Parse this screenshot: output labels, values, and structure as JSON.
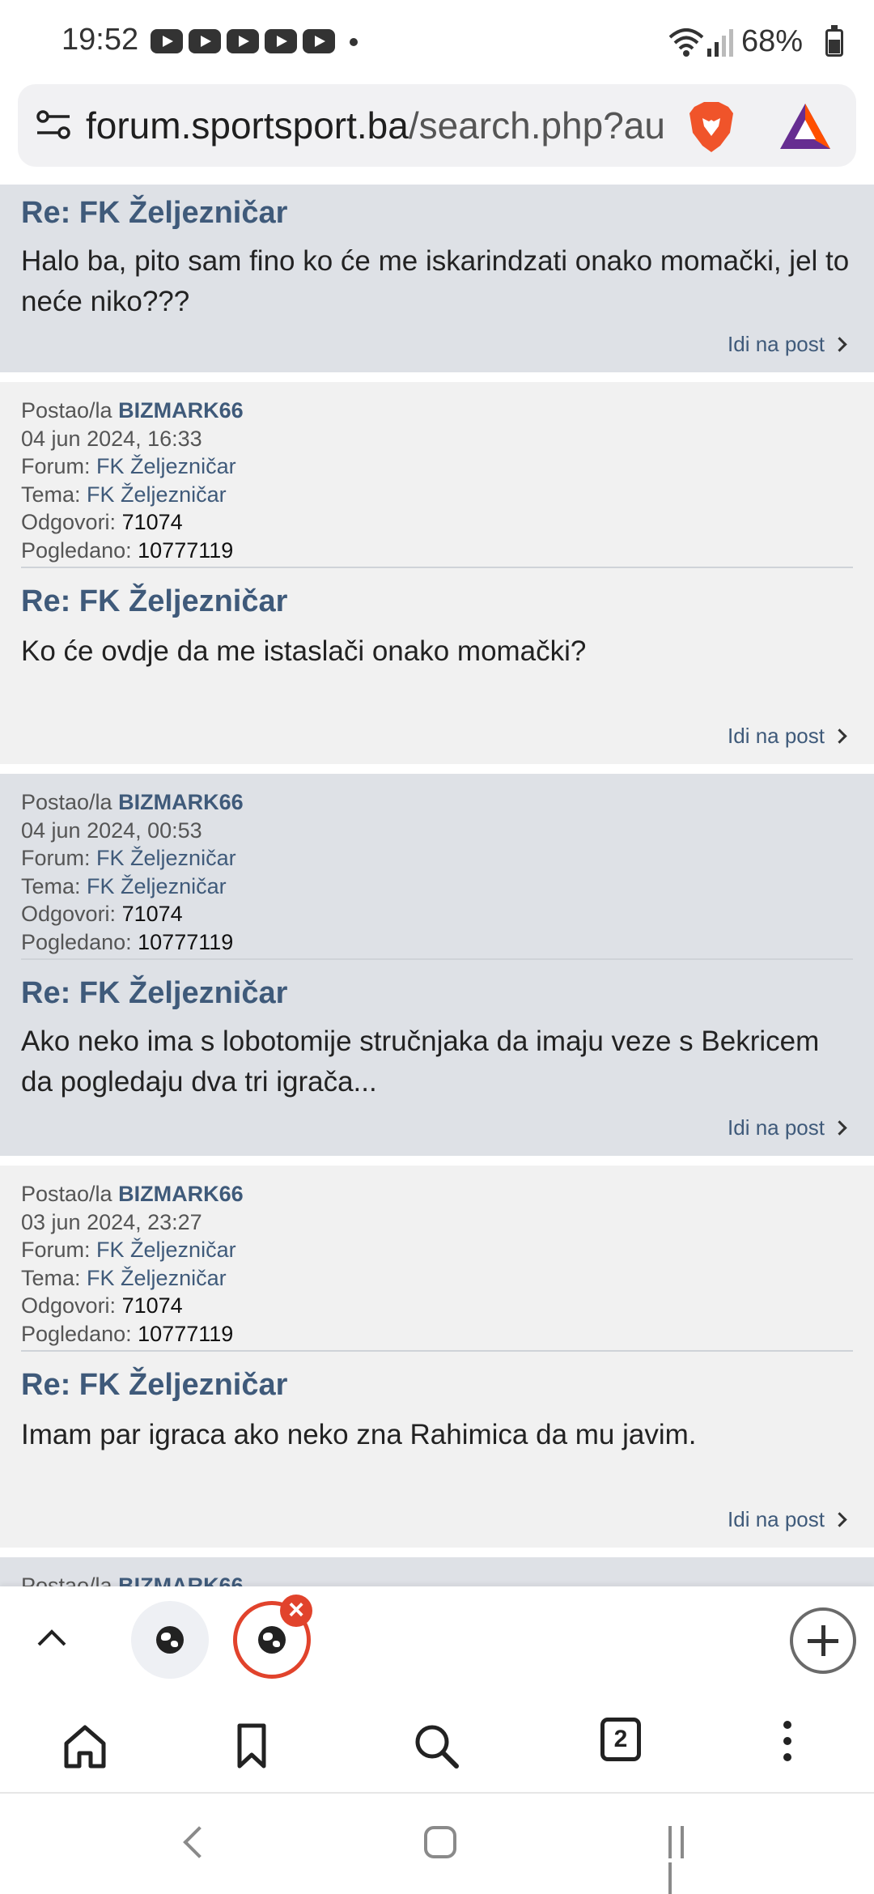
{
  "status_bar": {
    "time": "19:52",
    "battery": "68%"
  },
  "url_bar": {
    "host": "forum.sportsport.ba",
    "path": "/search.php?au"
  },
  "posts": [
    {
      "title": "Re: FK Željezničar",
      "body": "Halo ba, pito sam fino ko će me iskarindzati onako momački, jel to neće niko???",
      "goto": "Idi na post"
    },
    {
      "posted_by_label": "Postao/la",
      "user": "BIZMARK66",
      "date": "04 jun 2024, 16:33",
      "forum_label": "Forum:",
      "forum": "FK Željezničar",
      "topic_label": "Tema:",
      "topic": "FK Željezničar",
      "replies_label": "Odgovori:",
      "replies": "71074",
      "views_label": "Pogledano:",
      "views": "10777119",
      "title": "Re: FK Željezničar",
      "body": "Ko će ovdje da me istaslači onako momački?",
      "goto": "Idi na post"
    },
    {
      "posted_by_label": "Postao/la",
      "user": "BIZMARK66",
      "date": "04 jun 2024, 00:53",
      "forum_label": "Forum:",
      "forum": "FK Željezničar",
      "topic_label": "Tema:",
      "topic": "FK Željezničar",
      "replies_label": "Odgovori:",
      "replies": "71074",
      "views_label": "Pogledano:",
      "views": "10777119",
      "title": "Re: FK Željezničar",
      "body": "Ako neko ima s lobotomije stručnjaka da imaju veze s Bekricem da pogledaju dva tri igrača...",
      "goto": "Idi na post"
    },
    {
      "posted_by_label": "Postao/la",
      "user": "BIZMARK66",
      "date": "03 jun 2024, 23:27",
      "forum_label": "Forum:",
      "forum": "FK Željezničar",
      "topic_label": "Tema:",
      "topic": "FK Željezničar",
      "replies_label": "Odgovori:",
      "replies": "71074",
      "views_label": "Pogledano:",
      "views": "10777119",
      "title": "Re: FK Željezničar",
      "body": "Imam par igraca ako neko zna Rahimica da mu javim.",
      "goto": "Idi na post"
    },
    {
      "posted_by_label": "Postao/la",
      "user": "BIZMARK66"
    }
  ],
  "toolbar": {
    "tab_count": "2"
  },
  "icons": {
    "tune": "tune-icon",
    "brave": "brave-lion-icon",
    "bat": "bat-rewards-icon",
    "home": "home-icon",
    "bookmark": "bookmark-icon",
    "search": "search-icon",
    "tabs": "tabs-icon",
    "menu": "more-vert-icon"
  },
  "colors": {
    "accent": "#e1432c",
    "link": "#3f5a7a",
    "card_grey": "#dee1e6",
    "card_light": "#f1f1f1"
  }
}
